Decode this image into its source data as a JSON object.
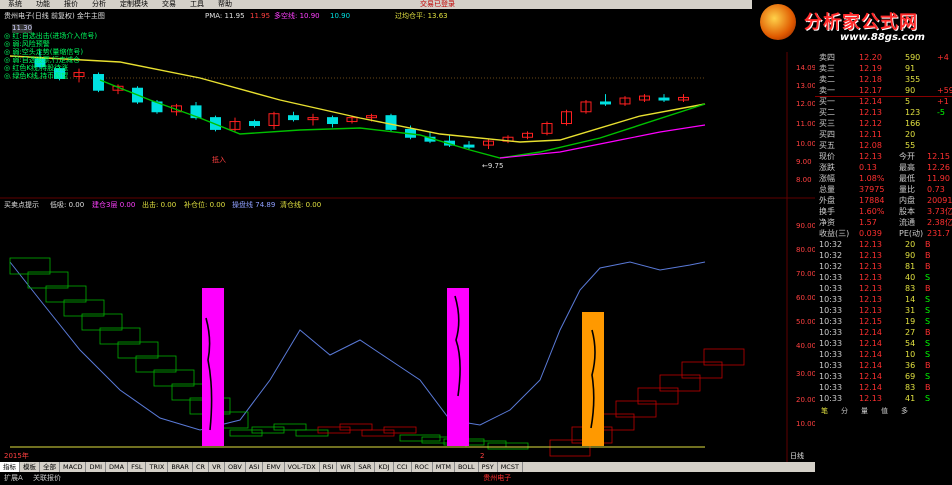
{
  "app": {
    "login_status": "交易已登录",
    "window_controls": [
      "_",
      "□",
      "×"
    ]
  },
  "menu": {
    "items": [
      "系统",
      "功能",
      "报价",
      "分析",
      "定制模块",
      "交易",
      "工具",
      "帮助"
    ]
  },
  "logo": {
    "text": "分析家公式网",
    "url": "www.88gs.com"
  },
  "upper": {
    "title": "贵州电子(日线 前复权) 金牛主图",
    "pma_label": "PMA:",
    "pma_value": "11.95",
    "val2": "11.95",
    "line_label": "多空线:",
    "line_value": "10.90",
    "val3": "10.90",
    "flat_label": "过均仓平:",
    "flat_value": "13.63",
    "legend": [
      "红:自选出击(进场介入信号)",
      "弱:风险预警",
      "弱:空头走势(量缩信号)",
      "弱:自选股票,行走减仓",
      "红色K线,持股待涨",
      "绿色K线,持币观望"
    ],
    "annotations": {
      "buy": "抵入",
      "low": "←9.75",
      "price_tag": "11.30"
    },
    "axis": [
      "14.09",
      "13.00",
      "12.00",
      "11.00",
      "10.00",
      "9.00",
      "8.00"
    ]
  },
  "lower": {
    "title": "买卖点提示",
    "labels": [
      {
        "k": "低吸:",
        "v": "0.00"
      },
      {
        "k": "建仓3层",
        "v": "0.00"
      },
      {
        "k": "出击:",
        "v": "0.00"
      },
      {
        "k": "补仓位:",
        "v": "0.00"
      },
      {
        "k": "操盘线",
        "v": "74.89"
      },
      {
        "k": "清仓线:",
        "v": "0.00"
      }
    ],
    "axis": [
      "90.00",
      "80.00",
      "70.00",
      "60.00",
      "50.00",
      "40.00",
      "30.00",
      "20.00",
      "10.00"
    ],
    "date": "2015年",
    "date2": "2",
    "period": "日线"
  },
  "quote": {
    "sells": [
      {
        "label": "卖四",
        "price": "12.20",
        "vol": "590",
        "chg": "+4"
      },
      {
        "label": "卖三",
        "price": "12.19",
        "vol": "91",
        "chg": ""
      },
      {
        "label": "卖二",
        "price": "12.18",
        "vol": "355",
        "chg": ""
      },
      {
        "label": "卖一",
        "price": "12.17",
        "vol": "90",
        "chg": "+59"
      }
    ],
    "buys": [
      {
        "label": "买一",
        "price": "12.14",
        "vol": "5",
        "chg": "+1"
      },
      {
        "label": "买二",
        "price": "12.13",
        "vol": "123",
        "chg": "-5"
      },
      {
        "label": "买三",
        "price": "12.12",
        "vol": "166",
        "chg": ""
      },
      {
        "label": "买四",
        "price": "12.11",
        "vol": "20",
        "chg": ""
      },
      {
        "label": "买五",
        "price": "12.08",
        "vol": "55",
        "chg": ""
      }
    ],
    "stats": [
      {
        "k1": "现价",
        "v1": "12.13",
        "k2": "今开",
        "v2": "12.15"
      },
      {
        "k1": "涨跌",
        "v1": "0.13",
        "k2": "最高",
        "v2": "12.26"
      },
      {
        "k1": "涨幅",
        "v1": "1.08%",
        "k2": "最低",
        "v2": "11.90"
      },
      {
        "k1": "总量",
        "v1": "37975",
        "k2": "量比",
        "v2": "0.73"
      },
      {
        "k1": "外盘",
        "v1": "17884",
        "k2": "内盘",
        "v2": "20091"
      },
      {
        "k1": "换手",
        "v1": "1.60%",
        "k2": "股本",
        "v2": "3.73亿"
      },
      {
        "k1": "净资",
        "v1": "1.57",
        "k2": "流通",
        "v2": "2.38亿"
      },
      {
        "k1": "收益(三)",
        "v1": "0.039",
        "k2": "PE(动)",
        "v2": "231.7"
      }
    ],
    "ticks": [
      {
        "t": "10:32",
        "p": "12.13",
        "v": "20",
        "d": "B"
      },
      {
        "t": "10:32",
        "p": "12.13",
        "v": "90",
        "d": "B"
      },
      {
        "t": "10:32",
        "p": "12.13",
        "v": "81",
        "d": "B"
      },
      {
        "t": "10:33",
        "p": "12.13",
        "v": "40",
        "d": "S"
      },
      {
        "t": "10:33",
        "p": "12.13",
        "v": "83",
        "d": "B"
      },
      {
        "t": "10:33",
        "p": "12.13",
        "v": "14",
        "d": "S"
      },
      {
        "t": "10:33",
        "p": "12.13",
        "v": "31",
        "d": "S"
      },
      {
        "t": "10:33",
        "p": "12.15",
        "v": "19",
        "d": "S"
      },
      {
        "t": "10:33",
        "p": "12.14",
        "v": "27",
        "d": "B"
      },
      {
        "t": "10:33",
        "p": "12.14",
        "v": "54",
        "d": "S"
      },
      {
        "t": "10:33",
        "p": "12.14",
        "v": "10",
        "d": "S"
      },
      {
        "t": "10:33",
        "p": "12.14",
        "v": "36",
        "d": "B"
      },
      {
        "t": "10:33",
        "p": "12.14",
        "v": "69",
        "d": "S"
      },
      {
        "t": "10:33",
        "p": "12.14",
        "v": "83",
        "d": "B"
      },
      {
        "t": "10:33",
        "p": "12.13",
        "v": "41",
        "d": "S"
      }
    ],
    "tabs": [
      "笔",
      "分",
      "量",
      "值",
      "多"
    ]
  },
  "bottom": {
    "tabs": [
      "指标",
      "模板",
      "全部",
      "MACD",
      "DMI",
      "DMA",
      "FSL",
      "TRIX",
      "BRAR",
      "CR",
      "VR",
      "OBV",
      "ASI",
      "EMV",
      "VOL-TDX",
      "RSI",
      "WR",
      "SAR",
      "KDJ",
      "CCI",
      "ROC",
      "MTM",
      "BOLL",
      "PSY",
      "MCST"
    ],
    "status_left": "扩展A",
    "status_mid": "关联报价",
    "status_red": "贵州电子"
  },
  "colors": {
    "up": "#ff2020",
    "down": "#00e0e0",
    "ma_yellow": "#e8e030",
    "ma_green": "#00c000",
    "ma_magenta": "#ff00ff",
    "highlight_magenta": "#ff00ff",
    "highlight_orange": "#ff9900",
    "blue_line": "#5a7ad8"
  }
}
